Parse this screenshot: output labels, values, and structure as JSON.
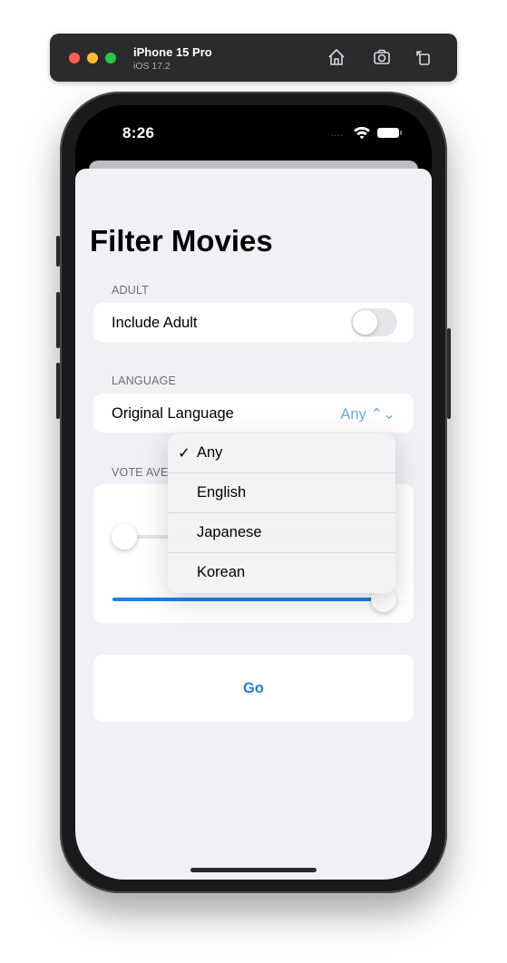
{
  "simulator": {
    "device_name": "iPhone 15 Pro",
    "os_version": "iOS 17.2",
    "toolbar_icons": [
      "home-icon",
      "screenshot-icon",
      "rotate-icon"
    ]
  },
  "status_bar": {
    "time": "8:26",
    "signal": "....",
    "icons": [
      "wifi-icon",
      "battery-icon"
    ]
  },
  "screen": {
    "title": "Filter Movies",
    "sections": {
      "adult": {
        "header": "ADULT",
        "row_label": "Include Adult",
        "toggle_on": false
      },
      "language": {
        "header": "LANGUAGE",
        "row_label": "Original Language",
        "value": "Any ⌃⌄"
      },
      "vote": {
        "header": "VOTE AVE"
      }
    },
    "go_button": "Go"
  },
  "language_menu": {
    "selected": "Any",
    "check": "✓",
    "options": [
      "Any",
      "English",
      "Japanese",
      "Korean"
    ]
  },
  "colors": {
    "accent": "#1b7fe6",
    "picker_value": "#6aa9ec",
    "background": "#f1f0f6"
  }
}
